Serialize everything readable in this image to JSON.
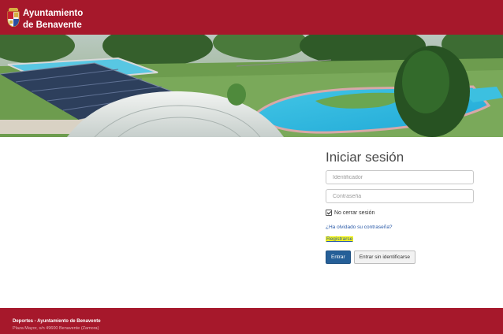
{
  "header": {
    "org_line1": "Ayuntamiento",
    "org_line2": "de Benavente",
    "logo_icon": "coat-of-arms-icon",
    "background_color": "#a6182b"
  },
  "banner": {
    "scene": "outdoor swimming pool complex with solar panels"
  },
  "login": {
    "title": "Iniciar sesión",
    "username_placeholder": "Identificador",
    "password_placeholder": "Contraseña",
    "remember_label": "No cerrar sesión",
    "remember_checked": true,
    "forgot_link": "¿Ha olvidado su contraseña?",
    "register_link": "Registrarse",
    "submit_label": "Entrar",
    "guest_label": "Entrar sin identificarse"
  },
  "footer": {
    "title": "Deportes - Ayuntamiento de Benavente",
    "address": "Plaza Mayor, s/n 49600 Benavente (Zamora)",
    "background_color": "#a6182b"
  }
}
